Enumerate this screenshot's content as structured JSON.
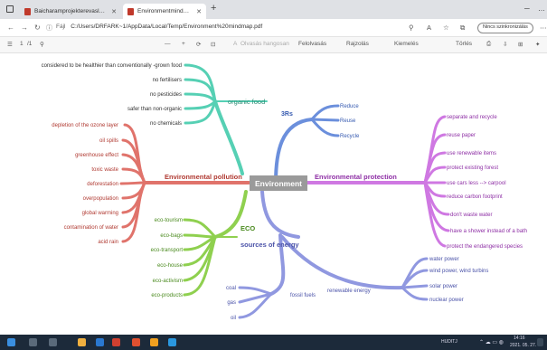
{
  "browser": {
    "tabs": [
      {
        "label": "Baicharamprojekterevaslsuh",
        "active": false
      },
      {
        "label": "Environmentmindmap.pdf",
        "active": true
      }
    ],
    "address": {
      "file_label": "Fájl",
      "path": "C:/Users/DRFARK~1/AppData/Local/Temp/Environment%20mindmap.pdf"
    },
    "signin_label": "Nincs szinkronizálás"
  },
  "pdf_toolbar": {
    "page_current": "1",
    "page_total": "/1",
    "zoom_out": "—",
    "zoom_in": "+",
    "read_aloud": "Olvasás hangosan",
    "read_aloud_icon": "A",
    "text_options": "Felolvasás",
    "draw": "Rajzolás",
    "highlight": "Kiemelés",
    "erase": "Törlés"
  },
  "mindmap": {
    "center": "Environment",
    "branches": {
      "organic_food": {
        "title": "organic food",
        "color": "#56d0b4",
        "items": [
          "considered to be healthier than conventionally -grown food",
          "no fertilisers",
          "no pesticides",
          "safer than non-organic",
          "no chemicals"
        ]
      },
      "rrr": {
        "title": "3Rs",
        "color": "#6b8fdc",
        "items": [
          "Reduce",
          "Reuse",
          "Recycle"
        ]
      },
      "pollution": {
        "title": "Environmental pollution",
        "color": "#e0736b",
        "items": [
          "depletion of the ozone layer",
          "oil spills",
          "greenhouse effect",
          "toxic waste",
          "deforestation",
          "overpopulation",
          "global warming",
          "contamination of water",
          "acid rain"
        ]
      },
      "protection": {
        "title": "Environmental protection",
        "color": "#cf78e2",
        "items": [
          "separate and recycle",
          "reuse paper",
          "use renewable items",
          "protect existing forest",
          "use cars less --> carpool",
          "reduce carbon footprint",
          "don't waste water",
          "have a shower instead of a bath",
          "protect the endangered species"
        ]
      },
      "eco": {
        "title": "ECO",
        "color": "#8fd04f",
        "items": [
          "eco-tourism",
          "eco-bags",
          "eco-transport",
          "eco-house",
          "eco-activism",
          "eco-products"
        ]
      },
      "energy": {
        "title": "sources of energy",
        "color": "#9098e0",
        "fossil_title": "fossil fuels",
        "fossil_items": [
          "coal",
          "gas",
          "oil"
        ],
        "renewable_title": "renewable energy",
        "renewable_items": [
          "water power",
          "wind power, wind turbins",
          "solar power",
          "nuclear power"
        ]
      }
    }
  },
  "taskbar": {
    "lang": "HUDITJ",
    "time": "14:16",
    "date": "2021. 05. 27."
  }
}
